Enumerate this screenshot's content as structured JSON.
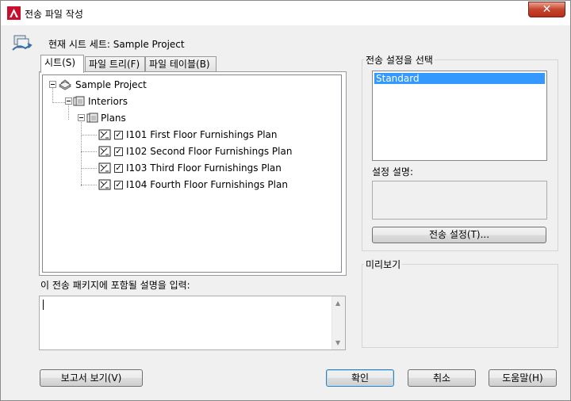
{
  "window": {
    "title": "전송 파일 작성",
    "close_label": "✕"
  },
  "current_sheet_set": "현재 시트 세트: Sample Project",
  "tabs": [
    {
      "label": "시트(S)",
      "active": true
    },
    {
      "label": "파일 트리(F)",
      "active": false
    },
    {
      "label": "파일 테이블(B)",
      "active": false
    }
  ],
  "tree": {
    "root": "Sample Project",
    "subset": "Interiors",
    "subsubset": "Plans",
    "sheets": [
      {
        "label": "I101 First Floor Furnishings Plan",
        "checked": true
      },
      {
        "label": "I102 Second Floor Furnishings Plan",
        "checked": true
      },
      {
        "label": "I103 Third Floor Furnishings Plan",
        "checked": true
      },
      {
        "label": "I104 Fourth Floor Furnishings Plan",
        "checked": true
      }
    ]
  },
  "description": {
    "label": "이 전송 패키지에 포함될 설명을 입력:",
    "value": ""
  },
  "setup": {
    "group_label": "전송 설정을 선택",
    "items": [
      "Standard"
    ],
    "selected": "Standard",
    "desc_label": "설정 설명:",
    "button_label": "전송 설정(T)..."
  },
  "preview": {
    "group_label": "미리보기"
  },
  "buttons": {
    "view_report": "보고서 보기(V)",
    "ok": "확인",
    "cancel": "취소",
    "help": "도움말(H)"
  },
  "colors": {
    "selection": "#3399ff",
    "close_button": "#c7432c",
    "app_icon": "#c8102e"
  }
}
